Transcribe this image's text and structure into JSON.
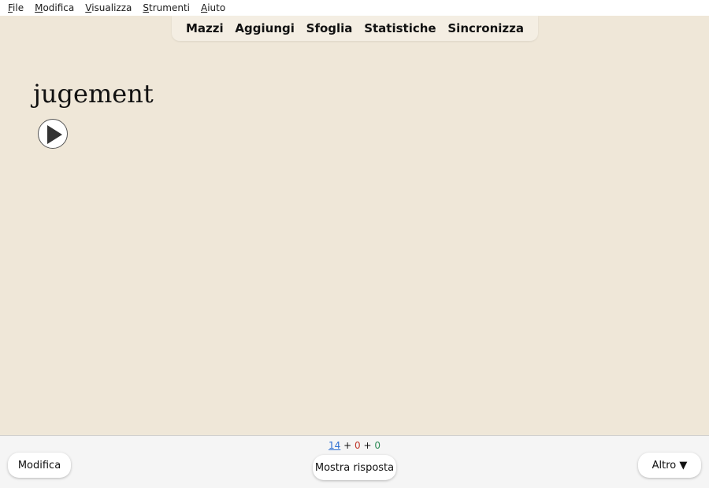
{
  "menubar": {
    "items": [
      {
        "first": "F",
        "rest": "ile"
      },
      {
        "first": "M",
        "rest": "odifica"
      },
      {
        "first": "V",
        "rest": "isualizza"
      },
      {
        "first": "S",
        "rest": "trumenti"
      },
      {
        "first": "A",
        "rest": "iuto"
      }
    ]
  },
  "toolbar": {
    "decks": "Mazzi",
    "add": "Aggiungi",
    "browse": "Sfoglia",
    "stats": "Statistiche",
    "sync": "Sincronizza"
  },
  "card": {
    "front": "jugement",
    "play_icon": "play-icon"
  },
  "bottombar": {
    "edit_label": "Modifica",
    "show_answer_label": "Mostra risposta",
    "more_label": "Altro ▼",
    "counts": {
      "new": "14",
      "learn": "0",
      "review": "0",
      "plus": "+"
    }
  },
  "colors": {
    "background": "#efe7d8",
    "new_count": "#2d6fd3",
    "learn_count": "#c0392b",
    "review_count": "#2e8b57"
  }
}
